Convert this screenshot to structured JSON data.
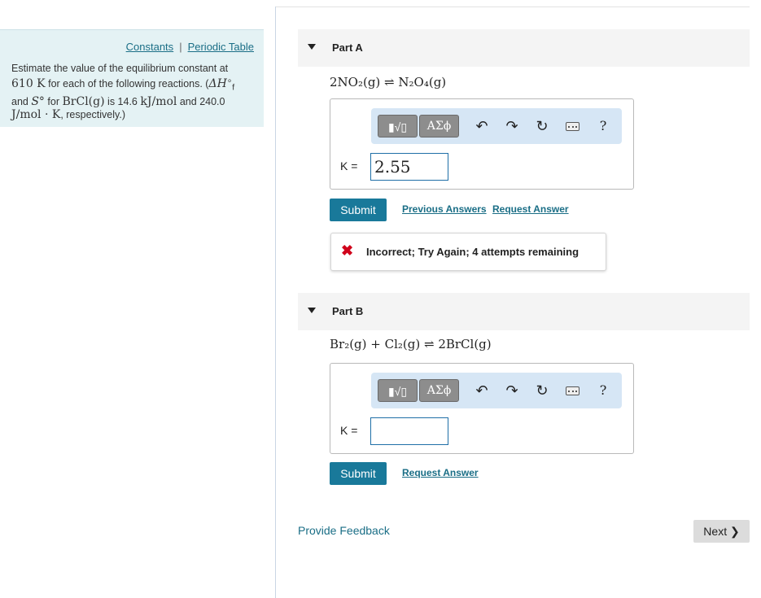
{
  "sidebar": {
    "constants_link": "Constants",
    "separator": "|",
    "periodic_table_link": "Periodic Table",
    "prompt": {
      "l1": "Estimate the value of the equilibrium constant at",
      "temp": "610 K",
      "l2a": "for each of the following reactions. (",
      "dhf": "ΔH",
      "dhf_sup": "∘",
      "dhf_sub": "f",
      "l3a": "and",
      "s": "S°",
      "l3b": "for",
      "species": "BrCl(g)",
      "l3c": "is 14.6",
      "unit1": "kJ/mol",
      "l3d": "and 240.0",
      "unit2": "J/mol · K",
      "l4": ", respectively.)"
    }
  },
  "parts": [
    {
      "title": "Part A",
      "equation": "2NO₂(g) ⇌ N₂O₄(g)",
      "k_label": "K =",
      "k_value": "2.55",
      "submit": "Submit",
      "links": [
        "Previous Answers",
        "Request Answer"
      ],
      "feedback": "Incorrect; Try Again; 4 attempts remaining"
    },
    {
      "title": "Part B",
      "equation": "Br₂(g) + Cl₂(g) ⇌ 2BrCl(g)",
      "k_label": "K =",
      "k_value": "",
      "submit": "Submit",
      "links": [
        "Request Answer"
      ]
    }
  ],
  "toolbar": {
    "templates": "▮√▯",
    "greek": "ΑΣϕ",
    "undo": "↶",
    "redo": "↷",
    "reset": "↻",
    "help": "?"
  },
  "footer": {
    "provide_feedback": "Provide Feedback",
    "next": "Next ❯"
  },
  "colors": {
    "accent": "#19799a",
    "link": "#1a6e86",
    "panel_bg": "#e4f2f4",
    "error": "#d0021b"
  }
}
